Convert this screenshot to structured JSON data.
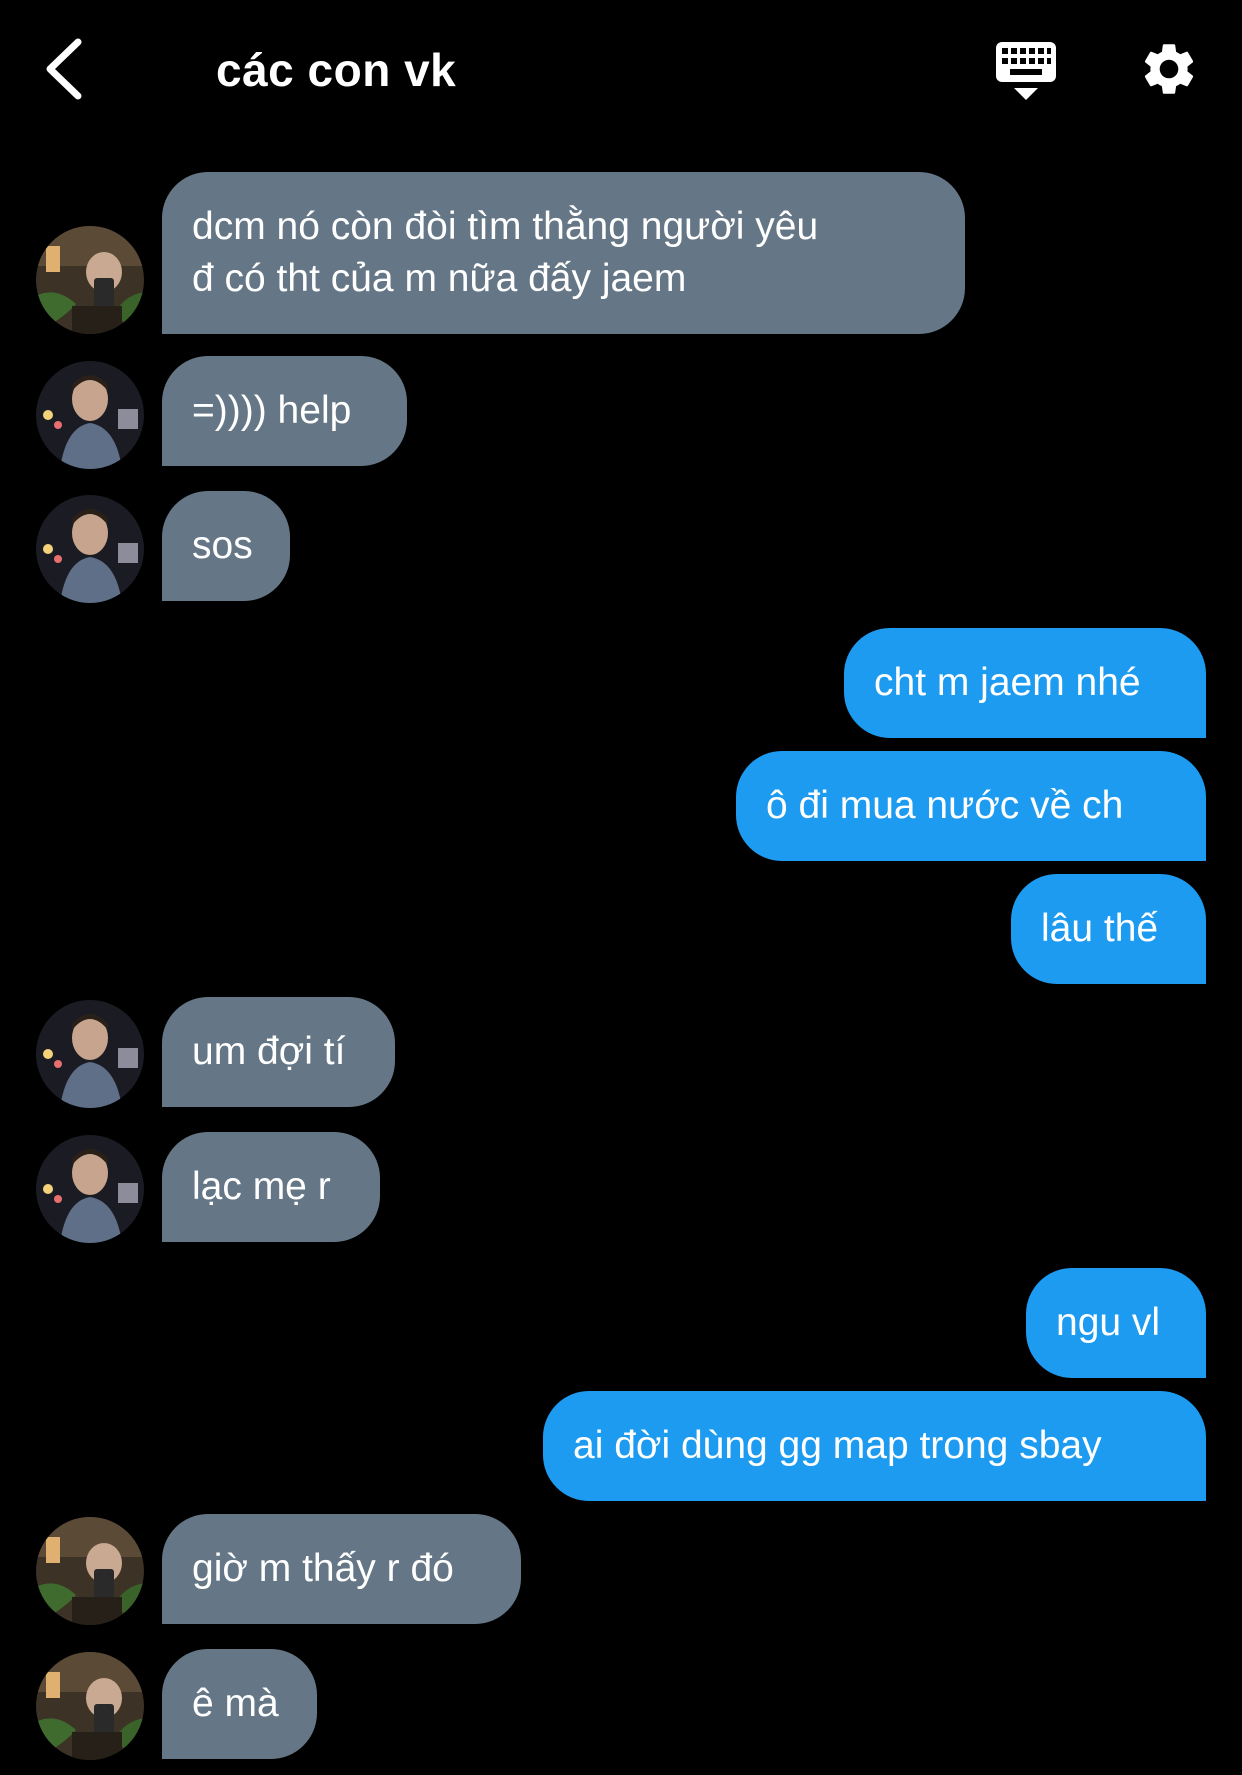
{
  "header": {
    "title": "các con vk",
    "back_icon": "chevron-left-icon",
    "keyboard_icon": "keyboard-icon",
    "settings_icon": "gear-icon"
  },
  "colors": {
    "background": "#000000",
    "incoming_bubble": "#657786",
    "outgoing_bubble": "#1d9bf0",
    "text": "#ffffff"
  },
  "messages": [
    {
      "side": "incoming",
      "text": "dcm nó còn đòi tìm thằng người yêu\nđ có tht của m nữa đấy jaem",
      "avatar": "avatar-a"
    },
    {
      "side": "incoming",
      "text": "=)))) help",
      "avatar": "avatar-b"
    },
    {
      "side": "incoming",
      "text": "sos",
      "avatar": "avatar-b"
    },
    {
      "side": "outgoing",
      "text": "cht m jaem nhé"
    },
    {
      "side": "outgoing",
      "text": "ô đi mua nước về ch"
    },
    {
      "side": "outgoing",
      "text": "lâu thế"
    },
    {
      "side": "incoming",
      "text": "um đợi tí",
      "avatar": "avatar-b"
    },
    {
      "side": "incoming",
      "text": "lạc mẹ r",
      "avatar": "avatar-b"
    },
    {
      "side": "outgoing",
      "text": "ngu vl"
    },
    {
      "side": "outgoing",
      "text": "ai đời dùng gg map trong sbay"
    },
    {
      "side": "incoming",
      "text": "giờ m thấy r đó",
      "avatar": "avatar-a"
    },
    {
      "side": "incoming",
      "text": "ê mà",
      "avatar": "avatar-a"
    }
  ]
}
